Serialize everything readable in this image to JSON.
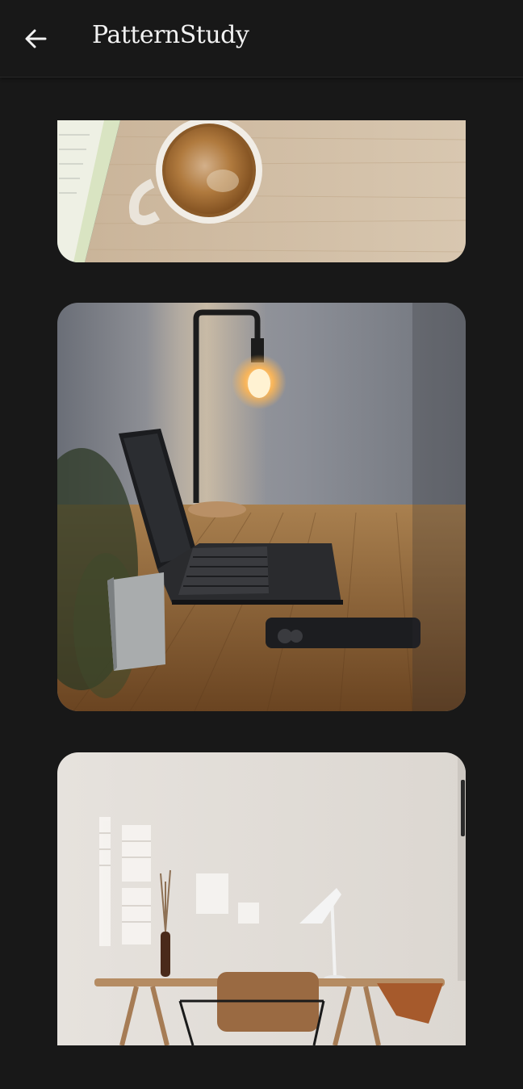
{
  "app_bar": {
    "title": "PatternStudy",
    "back_icon": "arrow-left-icon"
  },
  "gallery": {
    "images": [
      {
        "subject": "coffee-cup-on-wooden-desk"
      },
      {
        "subject": "laptop-desk-with-lamp"
      },
      {
        "subject": "minimal-desk-with-lamp-and-chair"
      }
    ]
  },
  "colors": {
    "background": "#181818",
    "title_text": "#f2f2f2"
  }
}
